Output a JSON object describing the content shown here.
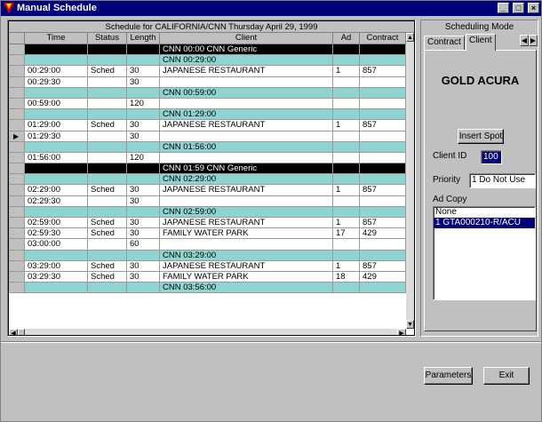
{
  "window": {
    "title": "Manual Schedule",
    "buttons": [
      "_",
      "□",
      "×"
    ]
  },
  "grid": {
    "caption": "Schedule for CALIFORNIA/CNN Thursday April 29, 1999",
    "columns": [
      "Time",
      "Status",
      "Length",
      "Client",
      "Ad",
      "Contract"
    ],
    "rows": [
      {
        "style": "black",
        "time": "",
        "status": "",
        "length": "",
        "client": "CNN    00:00 CNN Generic",
        "ad": "",
        "contract": "",
        "pointer": false
      },
      {
        "style": "cyan",
        "time": "",
        "status": "",
        "length": "",
        "client": "CNN    00:29:00",
        "ad": "",
        "contract": "",
        "pointer": false
      },
      {
        "style": "plain",
        "time": "00:29:00",
        "status": "Sched",
        "length": "30",
        "client": "JAPANESE RESTAURANT",
        "ad": "1",
        "contract": "857",
        "pointer": false
      },
      {
        "style": "plain",
        "time": "00:29:30",
        "status": "",
        "length": "30",
        "client": "",
        "ad": "",
        "contract": "",
        "pointer": false
      },
      {
        "style": "cyan",
        "time": "",
        "status": "",
        "length": "",
        "client": "CNN    00:59:00",
        "ad": "",
        "contract": "",
        "pointer": false
      },
      {
        "style": "plain",
        "time": "00:59:00",
        "status": "",
        "length": "120",
        "client": "",
        "ad": "",
        "contract": "",
        "pointer": false
      },
      {
        "style": "cyan",
        "time": "",
        "status": "",
        "length": "",
        "client": "CNN    01:29:00",
        "ad": "",
        "contract": "",
        "pointer": false
      },
      {
        "style": "plain",
        "time": "01:29:00",
        "status": "Sched",
        "length": "30",
        "client": "JAPANESE RESTAURANT",
        "ad": "1",
        "contract": "857",
        "pointer": false
      },
      {
        "style": "plain",
        "time": "01:29:30",
        "status": "",
        "length": "30",
        "client": "",
        "ad": "",
        "contract": "",
        "pointer": true
      },
      {
        "style": "cyan",
        "time": "",
        "status": "",
        "length": "",
        "client": "CNN    01:56:00",
        "ad": "",
        "contract": "",
        "pointer": false
      },
      {
        "style": "plain",
        "time": "01:56:00",
        "status": "",
        "length": "120",
        "client": "",
        "ad": "",
        "contract": "",
        "pointer": false
      },
      {
        "style": "black",
        "time": "",
        "status": "",
        "length": "",
        "client": "CNN    01:59 CNN Generic",
        "ad": "",
        "contract": "",
        "pointer": false
      },
      {
        "style": "cyan",
        "time": "",
        "status": "",
        "length": "",
        "client": "CNN    02:29:00",
        "ad": "",
        "contract": "",
        "pointer": false
      },
      {
        "style": "plain",
        "time": "02:29:00",
        "status": "Sched",
        "length": "30",
        "client": "JAPANESE RESTAURANT",
        "ad": "1",
        "contract": "857",
        "pointer": false
      },
      {
        "style": "plain",
        "time": "02:29:30",
        "status": "",
        "length": "30",
        "client": "",
        "ad": "",
        "contract": "",
        "pointer": false
      },
      {
        "style": "cyan",
        "time": "",
        "status": "",
        "length": "",
        "client": "CNN    02:59:00",
        "ad": "",
        "contract": "",
        "pointer": false
      },
      {
        "style": "plain",
        "time": "02:59:00",
        "status": "Sched",
        "length": "30",
        "client": "JAPANESE RESTAURANT",
        "ad": "1",
        "contract": "857",
        "pointer": false
      },
      {
        "style": "plain",
        "time": "02:59:30",
        "status": "Sched",
        "length": "30",
        "client": "FAMILY WATER PARK",
        "ad": "17",
        "contract": "429",
        "pointer": false
      },
      {
        "style": "plain",
        "time": "03:00:00",
        "status": "",
        "length": "60",
        "client": "",
        "ad": "",
        "contract": "",
        "pointer": false
      },
      {
        "style": "cyan",
        "time": "",
        "status": "",
        "length": "",
        "client": "CNN    03:29:00",
        "ad": "",
        "contract": "",
        "pointer": false
      },
      {
        "style": "plain",
        "time": "03:29:00",
        "status": "Sched",
        "length": "30",
        "client": "JAPANESE RESTAURANT",
        "ad": "1",
        "contract": "857",
        "pointer": false
      },
      {
        "style": "plain",
        "time": "03:29:30",
        "status": "Sched",
        "length": "30",
        "client": "FAMILY WATER PARK",
        "ad": "18",
        "contract": "429",
        "pointer": false
      },
      {
        "style": "cyan",
        "time": "",
        "status": "",
        "length": "",
        "client": "CNN    03:56:00",
        "ad": "",
        "contract": "",
        "pointer": false
      }
    ]
  },
  "panel": {
    "title": "Scheduling Mode",
    "tabs": [
      "Contract",
      "Client"
    ],
    "active_tab": "Client",
    "client_name": "GOLD ACURA",
    "insert_spot_label": "Insert Spot",
    "client_id_label": "Client ID",
    "client_id_value": "100",
    "priority_label": "Priority",
    "priority_value": "1 Do Not Use",
    "ad_copy_label": "Ad Copy",
    "ad_copy_items": [
      "None",
      "1    GTA000210-R/ACU"
    ],
    "ad_copy_selected": 1
  },
  "footer": {
    "parameters_label": "Parameters",
    "exit_label": "Exit"
  },
  "colors": {
    "titlebar": "#00007b",
    "break_row": "#8fd4d0",
    "generic_row": "#000000"
  }
}
